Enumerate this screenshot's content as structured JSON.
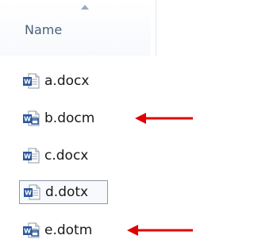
{
  "header": {
    "name_label": "Name"
  },
  "files": [
    {
      "name": "a.docx",
      "icon": "word-document-icon"
    },
    {
      "name": "b.docm",
      "icon": "word-macro-document-icon"
    },
    {
      "name": "c.docx",
      "icon": "word-document-icon"
    },
    {
      "name": "d.dotx",
      "icon": "word-template-icon"
    },
    {
      "name": "e.dotm",
      "icon": "word-macro-template-icon"
    }
  ],
  "colors": {
    "arrow": "#e00000",
    "word_blue": "#2b579a"
  }
}
